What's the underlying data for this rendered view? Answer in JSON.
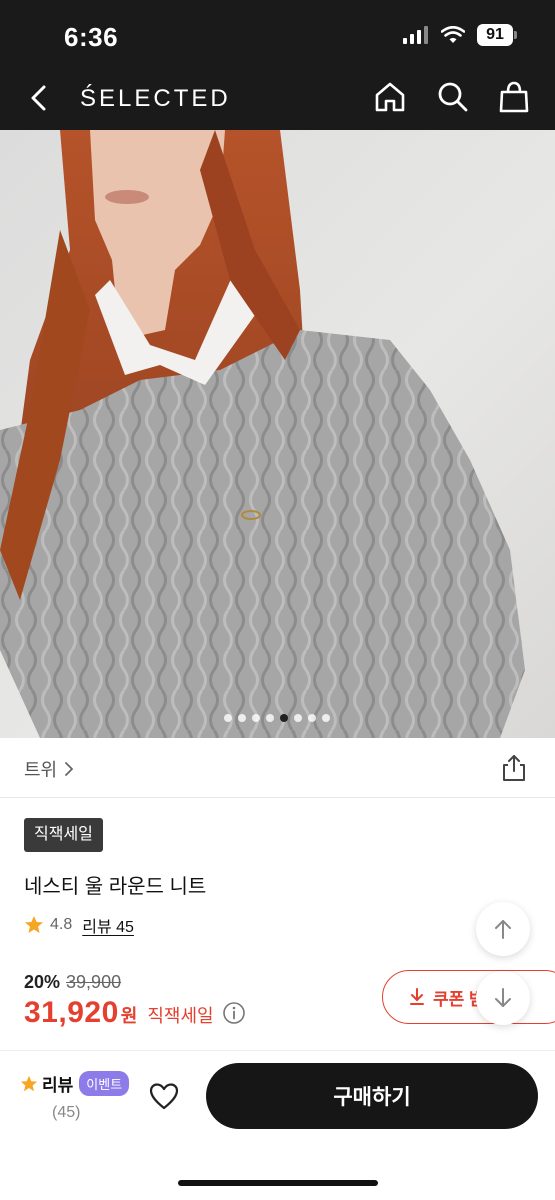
{
  "status": {
    "time": "6:36",
    "battery": "91"
  },
  "header": {
    "brand": "ŚELECTED"
  },
  "gallery": {
    "image_count": 8,
    "active_index": 4
  },
  "product": {
    "brand": "트위",
    "badge": "직잭세일",
    "title": "네스티 울 라운드 니트",
    "rating": "4.8",
    "review_label": "리뷰 45",
    "discount": "20%",
    "original_price": "39,900",
    "price": "31,920",
    "currency": "원",
    "sale_label": "직잭세일"
  },
  "coupon": {
    "label": "쿠폰 받"
  },
  "bottom": {
    "review_label": "리뷰",
    "event_badge": "이벤트",
    "review_count": "(45)",
    "buy_label": "구매하기"
  },
  "colors": {
    "accent": "#e5402f",
    "event": "#8c7be8",
    "dark": "#161616"
  }
}
